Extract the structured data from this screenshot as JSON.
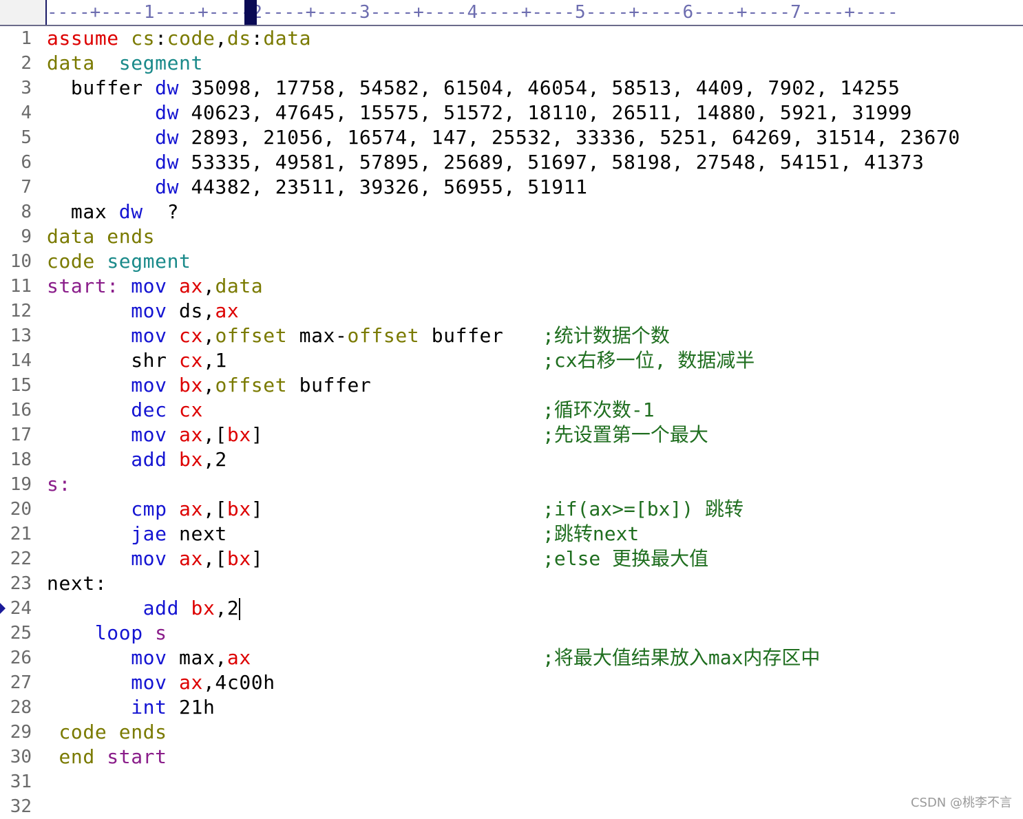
{
  "ruler": {
    "text": "----+----1----+----2----+----3----+----4----+----5----+----6----+----7----+----"
  },
  "lines": [
    {
      "n": "1",
      "segments": [
        [
          "assume",
          "kw-red"
        ],
        [
          " ",
          ""
        ],
        [
          "cs",
          "kw-olive"
        ],
        [
          ":",
          ""
        ],
        [
          "code",
          "kw-olive"
        ],
        [
          ",",
          ""
        ],
        [
          "ds",
          "kw-olive"
        ],
        [
          ":",
          ""
        ],
        [
          "data",
          "kw-olive"
        ]
      ],
      "comment": ""
    },
    {
      "n": "2",
      "segments": [
        [
          "data",
          "kw-olive"
        ],
        [
          "  ",
          ""
        ],
        [
          "segment",
          "kw-teal"
        ]
      ],
      "comment": ""
    },
    {
      "n": "3",
      "segments": [
        [
          "  buffer ",
          "kw-black"
        ],
        [
          "dw",
          "kw-blue"
        ],
        [
          " 35098, 17758, 54582, 61504, 46054, 58513, 4409, 7902, 14255",
          "num"
        ]
      ],
      "comment": ""
    },
    {
      "n": "4",
      "segments": [
        [
          "         ",
          ""
        ],
        [
          "dw",
          "kw-blue"
        ],
        [
          " 40623, 47645, 15575, 51572, 18110, 26511, 14880, 5921, 31999",
          "num"
        ]
      ],
      "comment": ""
    },
    {
      "n": "5",
      "segments": [
        [
          "         ",
          ""
        ],
        [
          "dw",
          "kw-blue"
        ],
        [
          " 2893, 21056, 16574, 147, 25532, 33336, 5251, 64269, 31514, 23670",
          "num"
        ]
      ],
      "comment": ""
    },
    {
      "n": "6",
      "segments": [
        [
          "         ",
          ""
        ],
        [
          "dw",
          "kw-blue"
        ],
        [
          " 53335, 49581, 57895, 25689, 51697, 58198, 27548, 54151, 41373",
          "num"
        ]
      ],
      "comment": ""
    },
    {
      "n": "7",
      "segments": [
        [
          "         ",
          ""
        ],
        [
          "dw",
          "kw-blue"
        ],
        [
          " 44382, 23511, 39326, 56955, 51911",
          "num"
        ]
      ],
      "comment": ""
    },
    {
      "n": "8",
      "segments": [
        [
          "  max ",
          "kw-black"
        ],
        [
          "dw",
          "kw-blue"
        ],
        [
          "  ?",
          "kw-black"
        ]
      ],
      "comment": ""
    },
    {
      "n": "9",
      "segments": [
        [
          "data ends",
          "kw-olive"
        ]
      ],
      "comment": ""
    },
    {
      "n": "10",
      "segments": [
        [
          "code",
          "kw-olive"
        ],
        [
          " ",
          ""
        ],
        [
          "segment",
          "kw-teal"
        ]
      ],
      "comment": ""
    },
    {
      "n": "11",
      "segments": [
        [
          "start: ",
          "kw-purple"
        ],
        [
          "mov",
          "kw-blue"
        ],
        [
          " ",
          ""
        ],
        [
          "ax",
          "kw-red"
        ],
        [
          ",",
          ""
        ],
        [
          "data",
          "kw-olive"
        ]
      ],
      "comment": ""
    },
    {
      "n": "12",
      "segments": [
        [
          "       ",
          ""
        ],
        [
          "mov",
          "kw-blue"
        ],
        [
          " ds,",
          "kw-black"
        ],
        [
          "ax",
          "kw-red"
        ]
      ],
      "comment": ""
    },
    {
      "n": "13",
      "segments": [
        [
          "       ",
          ""
        ],
        [
          "mov",
          "kw-blue"
        ],
        [
          " ",
          ""
        ],
        [
          "cx",
          "kw-red"
        ],
        [
          ",",
          ""
        ],
        [
          "offset",
          "kw-olive"
        ],
        [
          " max-",
          ""
        ],
        [
          "offset",
          "kw-olive"
        ],
        [
          " buffer",
          ""
        ]
      ],
      "comment": ";统计数据个数"
    },
    {
      "n": "14",
      "segments": [
        [
          "       ",
          ""
        ],
        [
          "shr",
          "kw-black"
        ],
        [
          " ",
          ""
        ],
        [
          "cx",
          "kw-red"
        ],
        [
          ",1",
          ""
        ]
      ],
      "comment": ";cx右移一位, 数据减半"
    },
    {
      "n": "15",
      "segments": [
        [
          "       ",
          ""
        ],
        [
          "mov",
          "kw-blue"
        ],
        [
          " ",
          ""
        ],
        [
          "bx",
          "kw-red"
        ],
        [
          ",",
          ""
        ],
        [
          "offset",
          "kw-olive"
        ],
        [
          " buffer",
          ""
        ]
      ],
      "comment": ""
    },
    {
      "n": "16",
      "segments": [
        [
          "       ",
          ""
        ],
        [
          "dec",
          "kw-blue"
        ],
        [
          " ",
          ""
        ],
        [
          "cx",
          "kw-red"
        ]
      ],
      "comment": ";循环次数-1"
    },
    {
      "n": "17",
      "segments": [
        [
          "       ",
          ""
        ],
        [
          "mov",
          "kw-blue"
        ],
        [
          " ",
          ""
        ],
        [
          "ax",
          "kw-red"
        ],
        [
          ",[",
          ""
        ],
        [
          "bx",
          "kw-red"
        ],
        [
          "]",
          ""
        ]
      ],
      "comment": ";先设置第一个最大"
    },
    {
      "n": "18",
      "segments": [
        [
          "       ",
          ""
        ],
        [
          "add",
          "kw-blue"
        ],
        [
          " ",
          ""
        ],
        [
          "bx",
          "kw-red"
        ],
        [
          ",2",
          ""
        ]
      ],
      "comment": ""
    },
    {
      "n": "19",
      "segments": [
        [
          "s:",
          "kw-purple"
        ]
      ],
      "comment": ""
    },
    {
      "n": "20",
      "segments": [
        [
          "       ",
          ""
        ],
        [
          "cmp",
          "kw-blue"
        ],
        [
          " ",
          ""
        ],
        [
          "ax",
          "kw-red"
        ],
        [
          ",[",
          ""
        ],
        [
          "bx",
          "kw-red"
        ],
        [
          "]",
          ""
        ]
      ],
      "comment": ";if(ax>=[bx]) 跳转"
    },
    {
      "n": "21",
      "segments": [
        [
          "       ",
          ""
        ],
        [
          "jae",
          "kw-blue"
        ],
        [
          " next",
          ""
        ]
      ],
      "comment": ";跳转next"
    },
    {
      "n": "22",
      "segments": [
        [
          "       ",
          ""
        ],
        [
          "mov",
          "kw-blue"
        ],
        [
          " ",
          ""
        ],
        [
          "ax",
          "kw-red"
        ],
        [
          ",[",
          ""
        ],
        [
          "bx",
          "kw-red"
        ],
        [
          "]",
          ""
        ]
      ],
      "comment": ";else 更换最大值"
    },
    {
      "n": "23",
      "segments": [
        [
          "next:",
          "kw-black"
        ]
      ],
      "comment": ""
    },
    {
      "n": "24",
      "segments": [
        [
          "        ",
          ""
        ],
        [
          "add",
          "kw-blue"
        ],
        [
          " ",
          ""
        ],
        [
          "bx",
          "kw-red"
        ],
        [
          ",2",
          ""
        ]
      ],
      "comment": "",
      "cursor": true
    },
    {
      "n": "25",
      "segments": [
        [
          "    ",
          ""
        ],
        [
          "loop",
          "kw-blue"
        ],
        [
          " ",
          ""
        ],
        [
          "s",
          "kw-purple"
        ]
      ],
      "comment": ""
    },
    {
      "n": "26",
      "segments": [
        [
          "       ",
          ""
        ],
        [
          "mov",
          "kw-blue"
        ],
        [
          " max,",
          ""
        ],
        [
          "ax",
          "kw-red"
        ]
      ],
      "comment": ";将最大值结果放入max内存区中"
    },
    {
      "n": "27",
      "segments": [
        [
          "       ",
          ""
        ],
        [
          "mov",
          "kw-blue"
        ],
        [
          " ",
          ""
        ],
        [
          "ax",
          "kw-red"
        ],
        [
          ",4c00h",
          ""
        ]
      ],
      "comment": ""
    },
    {
      "n": "28",
      "segments": [
        [
          "       ",
          ""
        ],
        [
          "int",
          "kw-blue"
        ],
        [
          " 21h",
          ""
        ]
      ],
      "comment": ""
    },
    {
      "n": "29",
      "segments": [
        [
          " code ends",
          "kw-olive"
        ]
      ],
      "comment": ""
    },
    {
      "n": "30",
      "segments": [
        [
          " end ",
          "kw-olive"
        ],
        [
          "start",
          "kw-purple"
        ]
      ],
      "comment": ""
    },
    {
      "n": "31",
      "segments": [],
      "comment": ""
    },
    {
      "n": "32",
      "segments": [],
      "comment": ""
    }
  ],
  "current_line": "24",
  "watermark": "CSDN @桃李不言",
  "colors": {
    "keyword_blue": "#1414d2",
    "register_red": "#dd0000",
    "directive_olive": "#7a7a00",
    "label_purple": "#8a1d8a",
    "segment_teal": "#1a8a8a",
    "comment_green": "#1f6e1f",
    "line_number_gray": "#6b6b6b"
  },
  "icons": {
    "current_line_marker": "current-line-marker-icon"
  }
}
